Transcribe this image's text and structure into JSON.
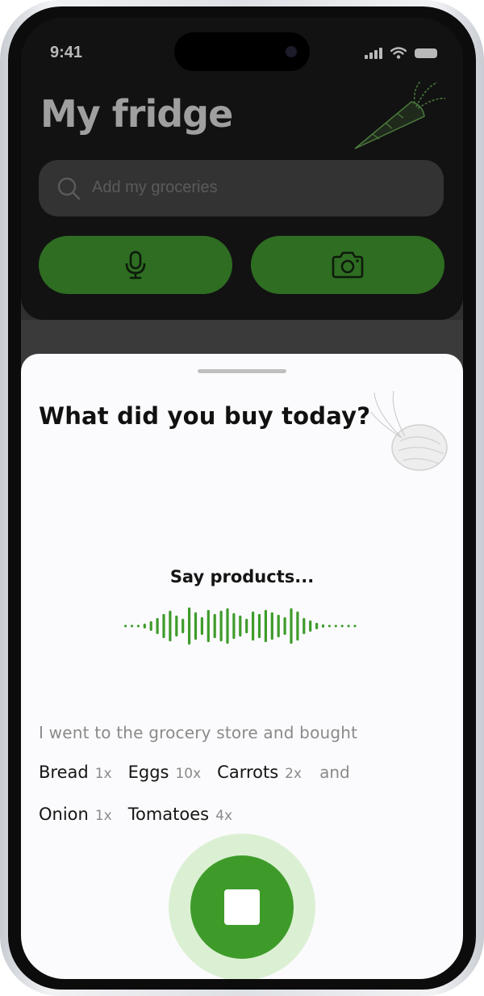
{
  "status_bar": {
    "time": "9:41"
  },
  "header": {
    "title": "My fridge"
  },
  "search": {
    "placeholder": "Add my groceries"
  },
  "actions": {
    "voice_icon": "microphone-icon",
    "camera_icon": "camera-icon"
  },
  "sheet": {
    "title": "What did you buy today?",
    "listening_prompt": "Say products...",
    "transcript_intro": "I went to the grocery store and bought",
    "products": [
      {
        "name": "Bread",
        "qty": "1x"
      },
      {
        "name": "Eggs",
        "qty": "10x"
      },
      {
        "name": "Carrots",
        "qty": "2x"
      },
      {
        "name": "Onion",
        "qty": "1x"
      },
      {
        "name": "Tomatoes",
        "qty": "4x"
      }
    ],
    "conjunction": "and",
    "stop_icon": "stop-icon"
  },
  "colors": {
    "accent_green": "#3e9b2a",
    "dim_green": "#2e6d22",
    "halo_green": "#dbf0d3"
  }
}
